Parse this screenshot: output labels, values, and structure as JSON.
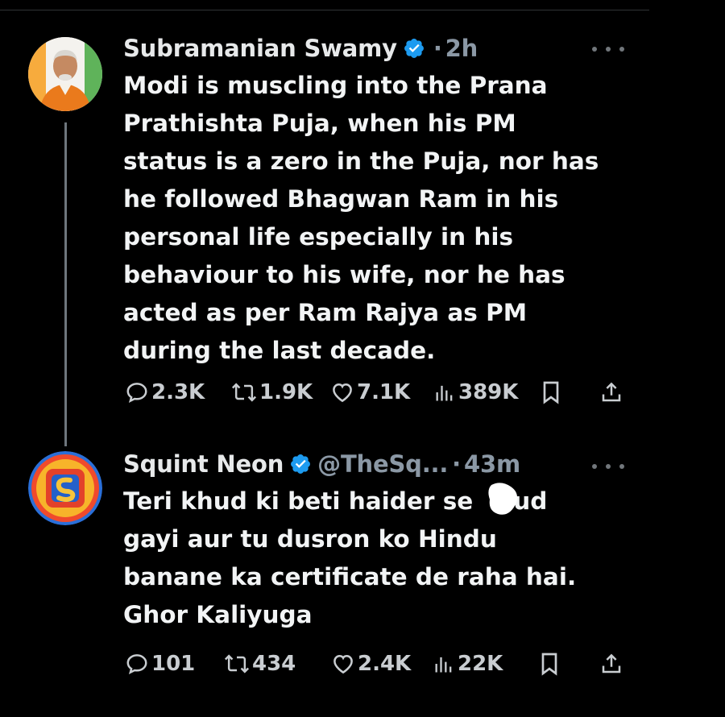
{
  "colors": {
    "background": "#000000",
    "text_primary": "#e7e9ea",
    "text_secondary": "#8b98a5",
    "verified_blue": "#1d9bf0",
    "thread_line": "#6e767d"
  },
  "tweets": [
    {
      "avatar_icon": "person-portrait-avatar",
      "display_name": "Subramanian Swamy",
      "verified": true,
      "handle": "",
      "separator": "·",
      "time": "2h",
      "text_lines": [
        "Modi is muscling into the Prana",
        "Prathishta Puja, when his PM",
        "status is a zero in the Puja, nor has",
        "he followed Bhagwan Ram in his",
        "personal life especially in his",
        "behaviour to his wife, nor he has",
        "acted as per Ram Rajya as PM",
        "during the last decade."
      ],
      "stats": {
        "replies": "2.3K",
        "reposts": "1.9K",
        "likes": "7.1K",
        "views": "389K"
      }
    },
    {
      "avatar_icon": "squint-neon-logo-avatar",
      "display_name": "Squint Neon",
      "verified": true,
      "handle": "@TheSq...",
      "separator": "·",
      "time": "43m",
      "text_lines": [
        "Teri khud ki beti haider se",
        "ud",
        "gayi aur tu dusron ko Hindu",
        "banane ka certificate de raha hai.",
        "Ghor Kaliyuga"
      ],
      "stats": {
        "replies": "101",
        "reposts": "434",
        "likes": "2.4K",
        "views": "22K"
      }
    }
  ]
}
